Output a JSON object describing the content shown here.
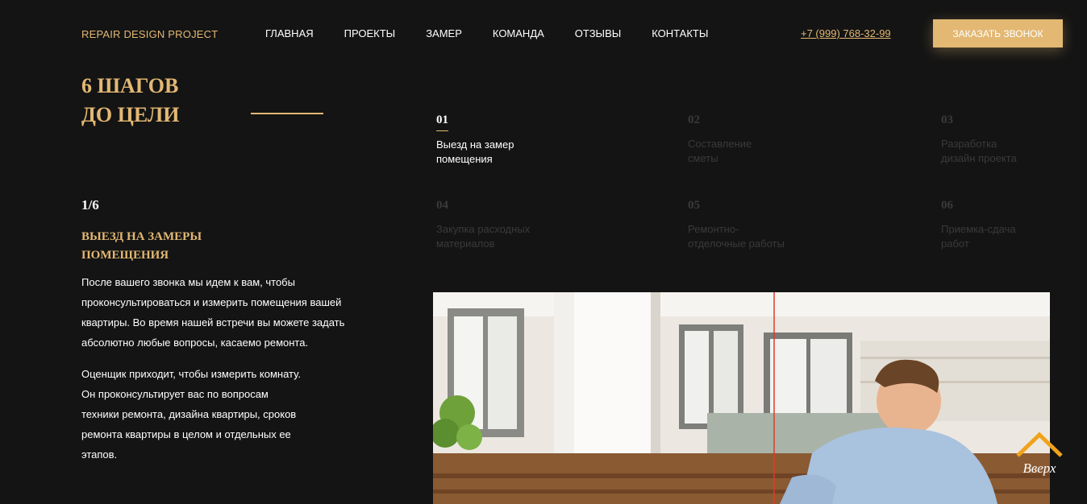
{
  "header": {
    "logo": "REPAIR DESIGN PROJECT",
    "nav": [
      "ГЛАВНАЯ",
      "ПРОЕКТЫ",
      "ЗАМЕР",
      "КОМАНДА",
      "ОТЗЫВЫ",
      "КОНТАКТЫ"
    ],
    "phone": "+7 (999) 768-32-99",
    "cta_label": "ЗАКАЗАТЬ ЗВОНОК"
  },
  "section": {
    "title_line1": "6 ШАГОВ",
    "title_line2": "ДО ЦЕЛИ"
  },
  "steps": [
    {
      "num": "01",
      "line1": "Выезд на замер",
      "line2": "помещения",
      "active": true
    },
    {
      "num": "02",
      "line1": "Составление",
      "line2": "сметы",
      "active": false
    },
    {
      "num": "03",
      "line1": "Разработка",
      "line2": "дизайн проекта",
      "active": false
    },
    {
      "num": "04",
      "line1": "Закупка расходных",
      "line2": "материалов",
      "active": false
    },
    {
      "num": "05",
      "line1": "Ремонтно-",
      "line2": "отделочные работы",
      "active": false
    },
    {
      "num": "06",
      "line1": "Приемка-сдача",
      "line2": "работ",
      "active": false
    }
  ],
  "current": {
    "counter": "1/6",
    "heading_line1": "ВЫЕЗД НА ЗАМЕРЫ",
    "heading_line2": "ПОМЕЩЕНИЯ",
    "para1": [
      "После вашего звонка мы идем к вам, чтобы",
      "проконсультироваться и измерить помещения вашей",
      "квартиры. Во время нашей встречи вы можете задать",
      "абсолютно любые вопросы, касаемо ремонта."
    ],
    "para2": [
      "Оценщик приходит, чтобы измерить комнату.",
      "Он проконсультирует вас по вопросам",
      "техники ремонта, дизайна квартиры, сроков",
      "ремонта квартиры в целом и отдельных ее",
      "этапов."
    ]
  },
  "back_to_top": {
    "label": "Вверх"
  },
  "colors": {
    "accent": "#e3b873",
    "background": "#141414",
    "inactive": "#3a3a3a"
  }
}
